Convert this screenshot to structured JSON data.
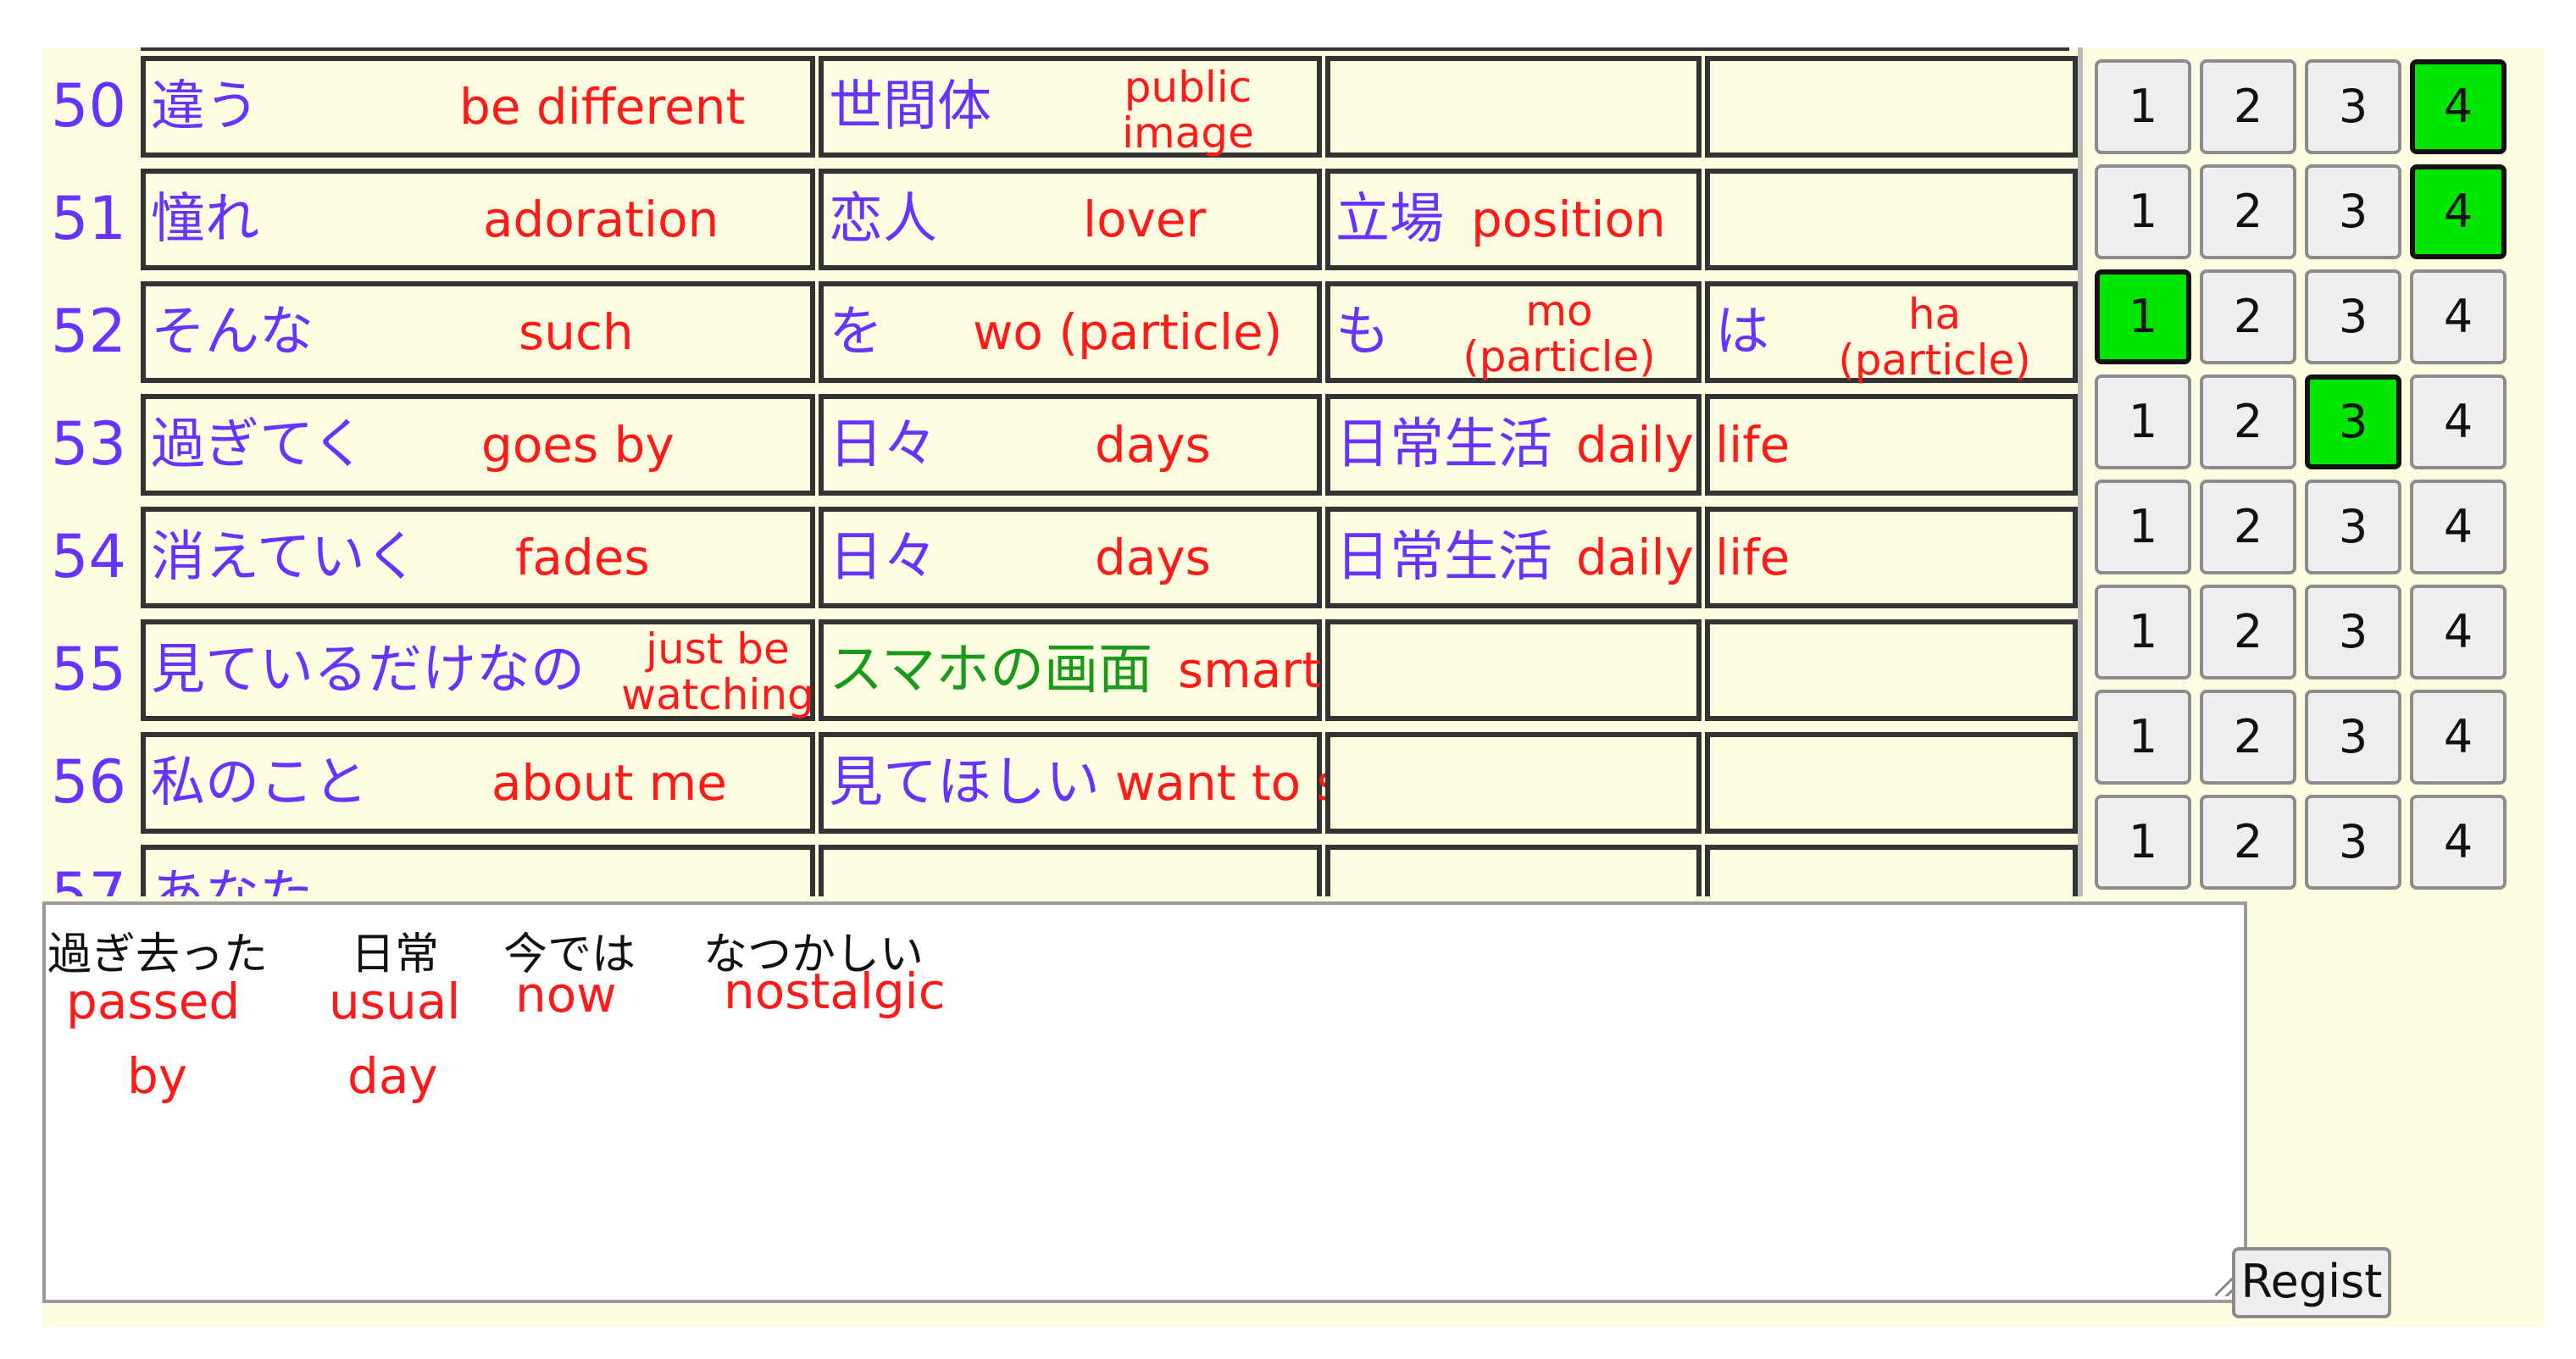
{
  "rows": [
    {
      "num": "50",
      "jp1": "違う",
      "en1": "be different",
      "jp2": "世間体",
      "en2a": "public",
      "en2b": "image",
      "jp3": "",
      "en3": "",
      "jp4": "",
      "en4": ""
    },
    {
      "num": "51",
      "jp1": "憧れ",
      "en1": "adoration",
      "jp2": "恋人",
      "en2": "lover",
      "jp3": "立場",
      "en3": "position",
      "jp4": "",
      "en4": ""
    },
    {
      "num": "52",
      "jp1": "そんな",
      "en1": "such",
      "jp2": "を",
      "en2": "wo (particle)",
      "jp3": "も",
      "en3a": "mo",
      "en3b": "(particle)",
      "jp4": "は",
      "en4a": "ha",
      "en4b": "(particle)"
    },
    {
      "num": "53",
      "jp1": "過ぎてく",
      "en1": "goes by",
      "jp2": "日々",
      "en2": "days",
      "jp3": "日常生活",
      "en3": "daily",
      "jp4": "",
      "en4": "life"
    },
    {
      "num": "54",
      "jp1": "消えていく",
      "en1": "fades",
      "jp2": "日々",
      "en2": "days",
      "jp3": "日常生活",
      "en3": "daily",
      "jp4": "",
      "en4": "life"
    },
    {
      "num": "55",
      "jp1": "見ているだけなの",
      "en1a": "just be",
      "en1b": "watching",
      "jp2": "スマホの画面",
      "en2": "smartphone screen",
      "jp3": "",
      "en3": "",
      "jp4": "",
      "en4": ""
    },
    {
      "num": "56",
      "jp1": "私のこと",
      "en1": "about me",
      "jp2": "見てほしい",
      "en2": "want to see",
      "jp3": "",
      "en3": "",
      "jp4": "",
      "en4": ""
    },
    {
      "num": "57",
      "jp1": "あなた",
      "en1": "",
      "jp2": "",
      "en2": "",
      "jp3": "",
      "en3": "",
      "jp4": "",
      "en4": ""
    }
  ],
  "rating": {
    "labels": [
      "1",
      "2",
      "3",
      "4"
    ],
    "selected": [
      4,
      4,
      1,
      3,
      0,
      0,
      0,
      0
    ],
    "selected_color": "#00e600"
  },
  "memo": {
    "jp": [
      "過ぎ去った",
      "日常",
      "今では",
      "なつかしい"
    ],
    "en": [
      "passed",
      "by",
      "usual",
      "day",
      "now",
      "nostalgic"
    ]
  },
  "regist_label": "Regist",
  "colors": {
    "japanese": "#6633ff",
    "english": "#ff1a1a",
    "highlight_green": "#1a9a1a",
    "panel_bg": "#fffde1"
  }
}
